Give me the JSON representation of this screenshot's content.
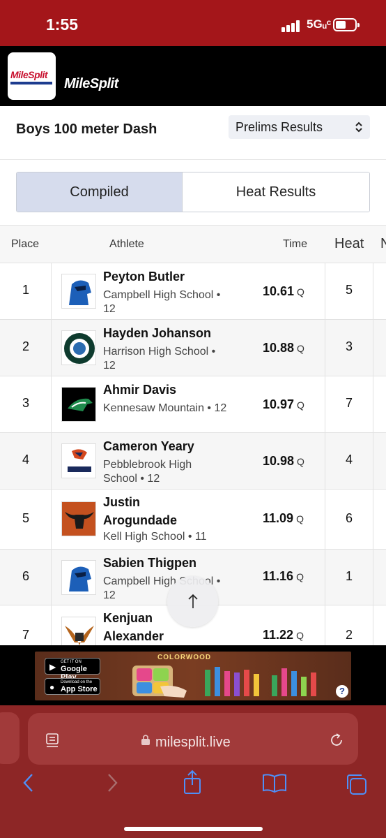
{
  "status_bar": {
    "time": "1:55",
    "network": "5Gᵤᶜ"
  },
  "header": {
    "logo_text": "MileSplit",
    "brand": "MileSplit"
  },
  "event": {
    "title": "Boys 100 meter Dash",
    "round_selected": "Prelims Results"
  },
  "tabs": {
    "compiled": "Compiled",
    "heat_results": "Heat Results"
  },
  "table": {
    "headers": {
      "place": "Place",
      "athlete": "Athlete",
      "time": "Time",
      "heat": "Heat",
      "next": "N"
    },
    "rows": [
      {
        "place": "1",
        "name": "Peyton Butler",
        "school": "Campbell High School • 12",
        "time": "10.61",
        "qual": "Q",
        "heat": "5"
      },
      {
        "place": "2",
        "name": "Hayden Johanson",
        "school": "Harrison High School • 12",
        "time": "10.88",
        "qual": "Q",
        "heat": "3"
      },
      {
        "place": "3",
        "name": "Ahmir Davis",
        "school": "Kennesaw Mountain • 12",
        "time": "10.97",
        "qual": "Q",
        "heat": "7"
      },
      {
        "place": "4",
        "name": "Cameron Yeary",
        "school": "Pebblebrook High School • 12",
        "time": "10.98",
        "qual": "Q",
        "heat": "4"
      },
      {
        "place": "5",
        "name": "Justin Arogundade",
        "school": "Kell High School • 11",
        "time": "11.09",
        "qual": "Q",
        "heat": "6"
      },
      {
        "place": "6",
        "name": "Sabien Thigpen",
        "school": "Campbell High School • 12",
        "time": "11.16",
        "qual": "Q",
        "heat": "1"
      },
      {
        "place": "7",
        "name": "Kenjuan Alexander",
        "school": "",
        "time": "11.22",
        "qual": "Q",
        "heat": "2"
      }
    ]
  },
  "ad": {
    "google_small": "GET IT ON",
    "google_big": "Google Play",
    "apple_small": "Download on the",
    "apple_big": "App Store",
    "title": "COLORWOOD",
    "help": "?"
  },
  "browser": {
    "url": "milesplit.live"
  },
  "colors": {
    "status_bar": "#a4161a",
    "browser_chrome": "#8d2626",
    "tab_active": "#d6dced"
  }
}
